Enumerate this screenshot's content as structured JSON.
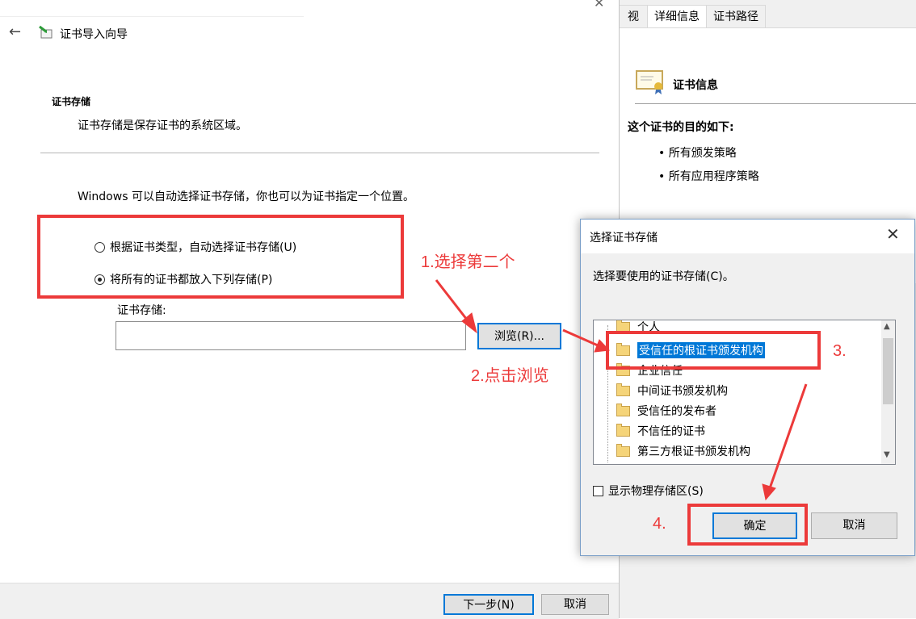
{
  "cert_window": {
    "tabs": [
      "视",
      "详细信息",
      "证书路径"
    ],
    "info_title": "证书信息",
    "purpose_heading": "这个证书的目的如下:",
    "purposes": [
      "• 所有颁发策略",
      "• 所有应用程序策略"
    ]
  },
  "wizard": {
    "close_glyph": "✕",
    "back_glyph": "←",
    "title": "证书导入向导",
    "section_title": "证书存储",
    "section_desc": "证书存储是保存证书的系统区域。",
    "auto_desc": "Windows 可以自动选择证书存储，你也可以为证书指定一个位置。",
    "radio_auto": "根据证书类型，自动选择证书存储(U)",
    "radio_manual": "将所有的证书都放入下列存储(P)",
    "store_label": "证书存储:",
    "store_value": "",
    "browse_button": "浏览(R)...",
    "next_button": "下一步(N)",
    "cancel_button": "取消"
  },
  "dialog": {
    "title": "选择证书存储",
    "close_glyph": "✕",
    "prompt": "选择要使用的证书存储(C)。",
    "tree_items": [
      "个人",
      "受信任的根证书颁发机构",
      "企业信任",
      "中间证书颁发机构",
      "受信任的发布者",
      "不信任的证书",
      "第三方根证书颁发机构"
    ],
    "selected_index": 1,
    "show_physical": "显示物理存储区(S)",
    "ok_button": "确定",
    "cancel_button": "取消"
  },
  "annotations": {
    "step1": "1.选择第二个",
    "step2": "2.点击浏览",
    "step3": "3.",
    "step4": "4.",
    "color": "#ec3a3a"
  }
}
